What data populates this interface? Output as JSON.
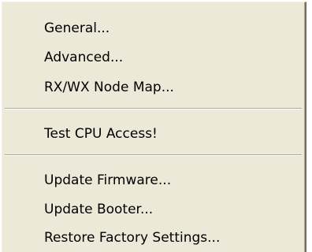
{
  "menu": {
    "items": [
      {
        "label": "General..."
      },
      {
        "label": "Advanced..."
      },
      {
        "label": "RX/WX Node Map..."
      },
      {
        "label": "Test CPU Access!"
      },
      {
        "label": "Update Firmware..."
      },
      {
        "label": "Update Booter..."
      },
      {
        "label": "Restore Factory Settings..."
      }
    ]
  },
  "colors": {
    "menu_background": "#ece9d8",
    "separator": "#aca899",
    "text": "#000000"
  }
}
